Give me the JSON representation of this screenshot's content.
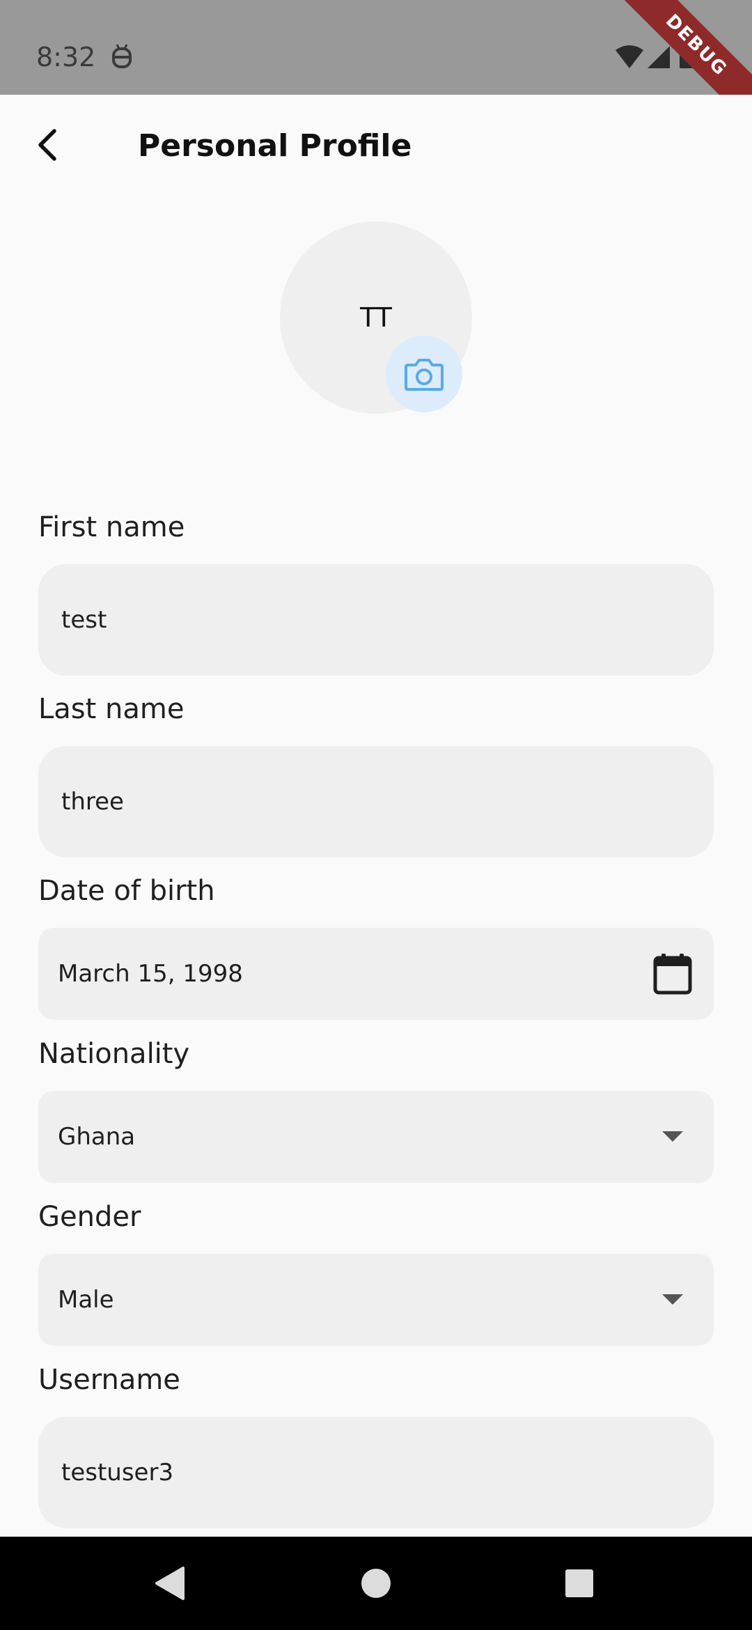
{
  "status_bar": {
    "time": "8:32",
    "debug_label": "DEBUG",
    "icons": [
      "android-bot-icon",
      "wifi-icon",
      "signal-icon",
      "battery-icon"
    ]
  },
  "app_bar": {
    "title": "Personal Profile",
    "back_icon": "chevron-left-icon"
  },
  "avatar": {
    "initials": "TT",
    "camera_icon": "camera-icon",
    "camera_color": "#5aa9e6",
    "camera_bg": "#dcecfb"
  },
  "form": {
    "first_name": {
      "label": "First name",
      "value": "test"
    },
    "last_name": {
      "label": "Last name",
      "value": "three"
    },
    "date_of_birth": {
      "label": "Date of birth",
      "value": "March 15, 1998",
      "icon": "calendar-icon"
    },
    "nationality": {
      "label": "Nationality",
      "value": "Ghana",
      "icon": "dropdown-arrow-icon"
    },
    "gender": {
      "label": "Gender",
      "value": "Male",
      "icon": "dropdown-arrow-icon"
    },
    "username": {
      "label": "Username",
      "value": "testuser3"
    }
  },
  "nav_bar": {
    "icons": [
      "back-triangle-icon",
      "home-circle-icon",
      "recents-square-icon"
    ]
  },
  "colors": {
    "background": "#fafafa",
    "field_fill": "#efefef",
    "status_bar": "#999999",
    "debug_banner": "#8e2a2a"
  }
}
